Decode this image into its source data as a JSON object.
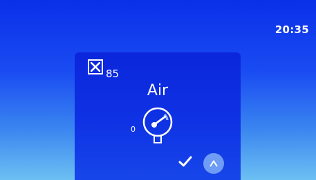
{
  "status_bar": {
    "time": "20:35"
  },
  "gas_panel": {
    "level_value": "85",
    "gas_name": "Air",
    "scale_min_label": "0",
    "icons": {
      "sensor_status": "x-box-icon",
      "gauge": "pressure-gauge-icon",
      "confirm": "checkmark-icon",
      "up": "chevron-up-icon"
    }
  },
  "colors": {
    "background_top": "#0a2fe8",
    "background_bottom": "#6cc0f2",
    "panel": "#0f33e4",
    "button": "#6f9cf4",
    "gauge_accent": "#8fb2f5",
    "text": "#ffffff"
  }
}
